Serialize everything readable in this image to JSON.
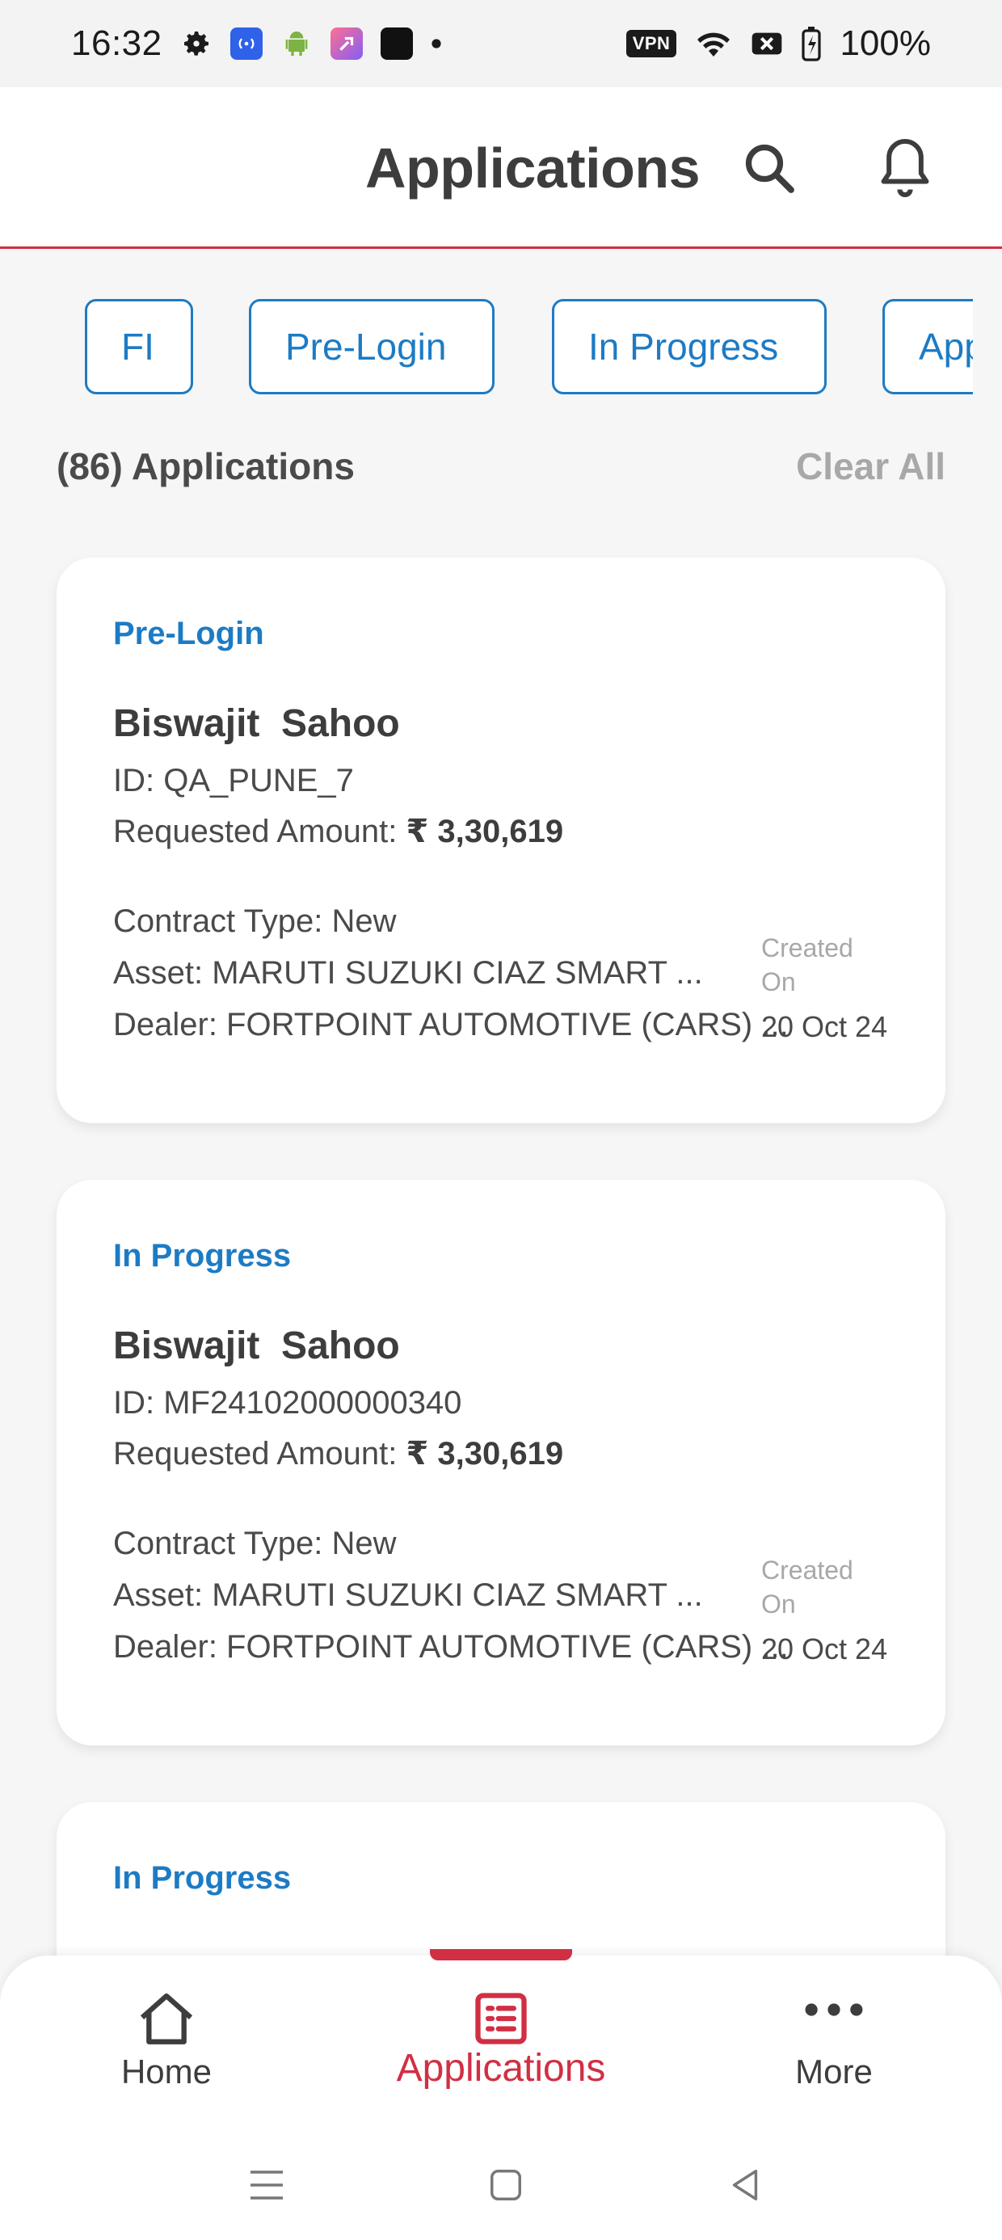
{
  "status_bar": {
    "time": "16:32",
    "battery": "100%",
    "vpn": "VPN",
    "icons": [
      "gear-icon",
      "broadcast-icon",
      "android-icon",
      "shortcut-app-icon",
      "black-app-icon",
      "dot-icon",
      "vpn-icon",
      "wifi-icon",
      "no-sim-icon",
      "battery-icon"
    ]
  },
  "header": {
    "title": "Applications",
    "icons": [
      "search-icon",
      "bell-icon"
    ]
  },
  "filters": [
    "FI",
    "Pre-Login",
    "In Progress",
    "App"
  ],
  "list": {
    "count_label": "(86) Applications",
    "clear_label": "Clear All"
  },
  "cards": [
    {
      "status": "Pre-Login",
      "name": "Biswajit  Sahoo",
      "id_line": "ID: QA_PUNE_7",
      "amount_label": "Requested Amount: ",
      "amount_value": "₹ 3,30,619",
      "contract": "Contract Type: New",
      "asset": "Asset: MARUTI SUZUKI CIAZ SMART ...",
      "dealer": "Dealer: FORTPOINT AUTOMOTIVE (CARS) ...",
      "created_label": "Created On",
      "created_date": "20 Oct 24"
    },
    {
      "status": "In Progress",
      "name": "Biswajit  Sahoo",
      "id_line": "ID: MF24102000000340",
      "amount_label": "Requested Amount: ",
      "amount_value": "₹ 3,30,619",
      "contract": "Contract Type: New",
      "asset": "Asset: MARUTI SUZUKI CIAZ SMART ...",
      "dealer": "Dealer: FORTPOINT AUTOMOTIVE (CARS) ...",
      "created_label": "Created On",
      "created_date": "20 Oct 24"
    },
    {
      "status": "In Progress"
    }
  ],
  "bottom_nav": [
    {
      "label": "Home",
      "icon": "home-icon"
    },
    {
      "label": "Applications",
      "icon": "list-icon",
      "active": true
    },
    {
      "label": "More",
      "icon": "more-icon"
    }
  ],
  "colors": {
    "accent_blue": "#1d7bc4",
    "accent_red": "#d12f44",
    "text_dark": "#3d3d3d",
    "muted": "#a8a8a8"
  }
}
